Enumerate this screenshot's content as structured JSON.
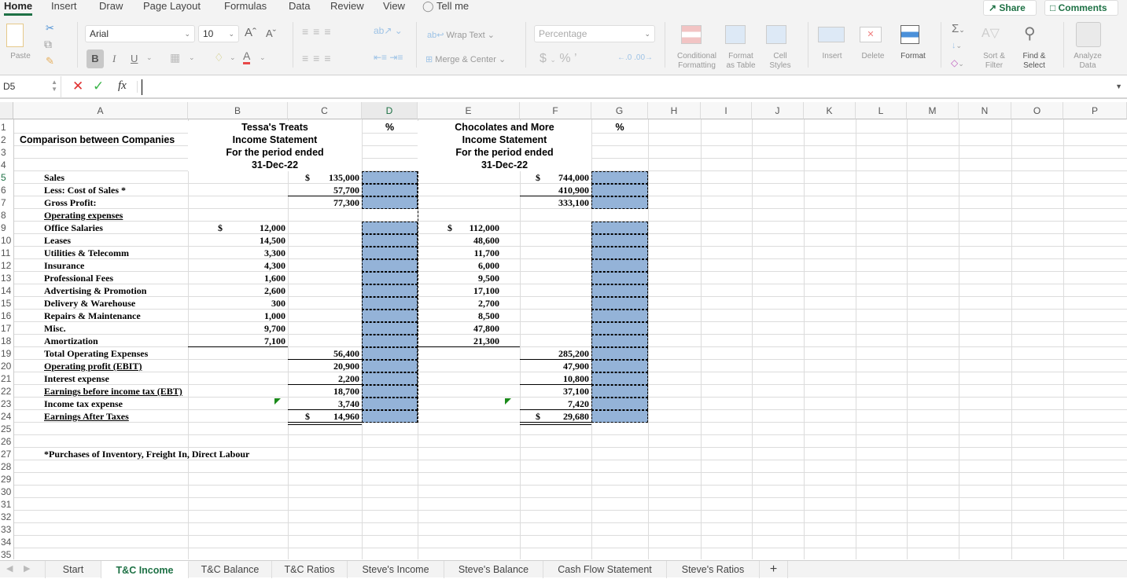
{
  "ribbon_tabs": [
    "Home",
    "Insert",
    "Draw",
    "Page Layout",
    "Formulas",
    "Data",
    "Review",
    "View",
    "Tell me"
  ],
  "active_ribbon_tab": "Home",
  "share_label": "Share",
  "comments_label": "Comments",
  "ribbon": {
    "paste": "Paste",
    "font_name": "Arial",
    "font_size": "10",
    "wrap_text": "Wrap Text",
    "merge_center": "Merge & Center",
    "number_format": "Percentage",
    "conditional_formatting": [
      "Conditional",
      "Formatting"
    ],
    "format_as_table": [
      "Format",
      "as Table"
    ],
    "cell_styles": [
      "Cell",
      "Styles"
    ],
    "insert": "Insert",
    "delete": "Delete",
    "format": "Format",
    "sort_filter": [
      "Sort &",
      "Filter"
    ],
    "find_select": [
      "Find &",
      "Select"
    ],
    "analyze_data": [
      "Analyze",
      "Data"
    ],
    "bold": "B",
    "italic": "I",
    "underline": "U"
  },
  "formula_bar": {
    "name_box": "D5",
    "fx": "fx",
    "value": ""
  },
  "columns": [
    "A",
    "B",
    "C",
    "D",
    "E",
    "F",
    "G",
    "H",
    "I",
    "J",
    "K",
    "L",
    "M",
    "N",
    "O",
    "P"
  ],
  "selected_column": "D",
  "selected_row": "5",
  "rows": [
    "1",
    "2",
    "3",
    "4",
    "5",
    "6",
    "7",
    "8",
    "9",
    "10",
    "11",
    "12",
    "13",
    "14",
    "15",
    "16",
    "17",
    "18",
    "19",
    "20",
    "21",
    "22",
    "23",
    "24",
    "25",
    "26",
    "27",
    "28",
    "29",
    "30",
    "31",
    "32",
    "33",
    "34",
    "35"
  ],
  "sheet": {
    "title_a": "Comparison between Companies",
    "company1": {
      "name": "Tessa's Treats",
      "line2": "Income Statement",
      "line3": "For the period ended",
      "date": "31-Dec-22",
      "pct": "%"
    },
    "company2": {
      "name": "Chocolates and More",
      "line2": "Income Statement",
      "line3": "For the period ended",
      "date": "31-Dec-22",
      "pct": "%"
    },
    "labels": [
      "Sales",
      "Less: Cost of Sales *",
      "Gross Profit:",
      "Operating expenses",
      "Office Salaries",
      "Leases",
      "Utilities & Telecomm",
      "Insurance",
      "Professional Fees",
      "Advertising & Promotion",
      "Delivery & Warehouse",
      "Repairs & Maintenance",
      "Misc.",
      "Amortization",
      "Total Operating Expenses",
      "Operating profit (EBIT)",
      "Interest expense",
      "Earnings before income tax (EBT)",
      "Income tax expense",
      "Earnings After Taxes"
    ],
    "c1_col_b": [
      "12,000",
      "14,500",
      "3,300",
      "4,300",
      "1,600",
      "2,600",
      "300",
      "1,000",
      "9,700",
      "7,100"
    ],
    "c1_col_c_top": [
      "135,000",
      "57,700",
      "77,300"
    ],
    "c1_col_c_bottom": [
      "56,400",
      "20,900",
      "2,200",
      "18,700",
      "3,740",
      "14,960"
    ],
    "c2_col_e": [
      "112,000",
      "48,600",
      "11,700",
      "6,000",
      "9,500",
      "17,100",
      "2,700",
      "8,500",
      "47,800",
      "21,300"
    ],
    "c2_col_f_top": [
      "744,000",
      "410,900",
      "333,100"
    ],
    "c2_col_f_bottom": [
      "285,200",
      "47,900",
      "10,800",
      "37,100",
      "7,420",
      "29,680"
    ],
    "currency": "$",
    "footnote": "*Purchases of Inventory, Freight In, Direct Labour"
  },
  "sheet_tabs": [
    "Start",
    "T&C Income",
    "T&C Balance",
    "T&C Ratios",
    "Steve's Income",
    "Steve's Balance",
    "Cash Flow Statement",
    "Steve's Ratios"
  ],
  "active_sheet": "T&C Income",
  "add_sheet": "+"
}
